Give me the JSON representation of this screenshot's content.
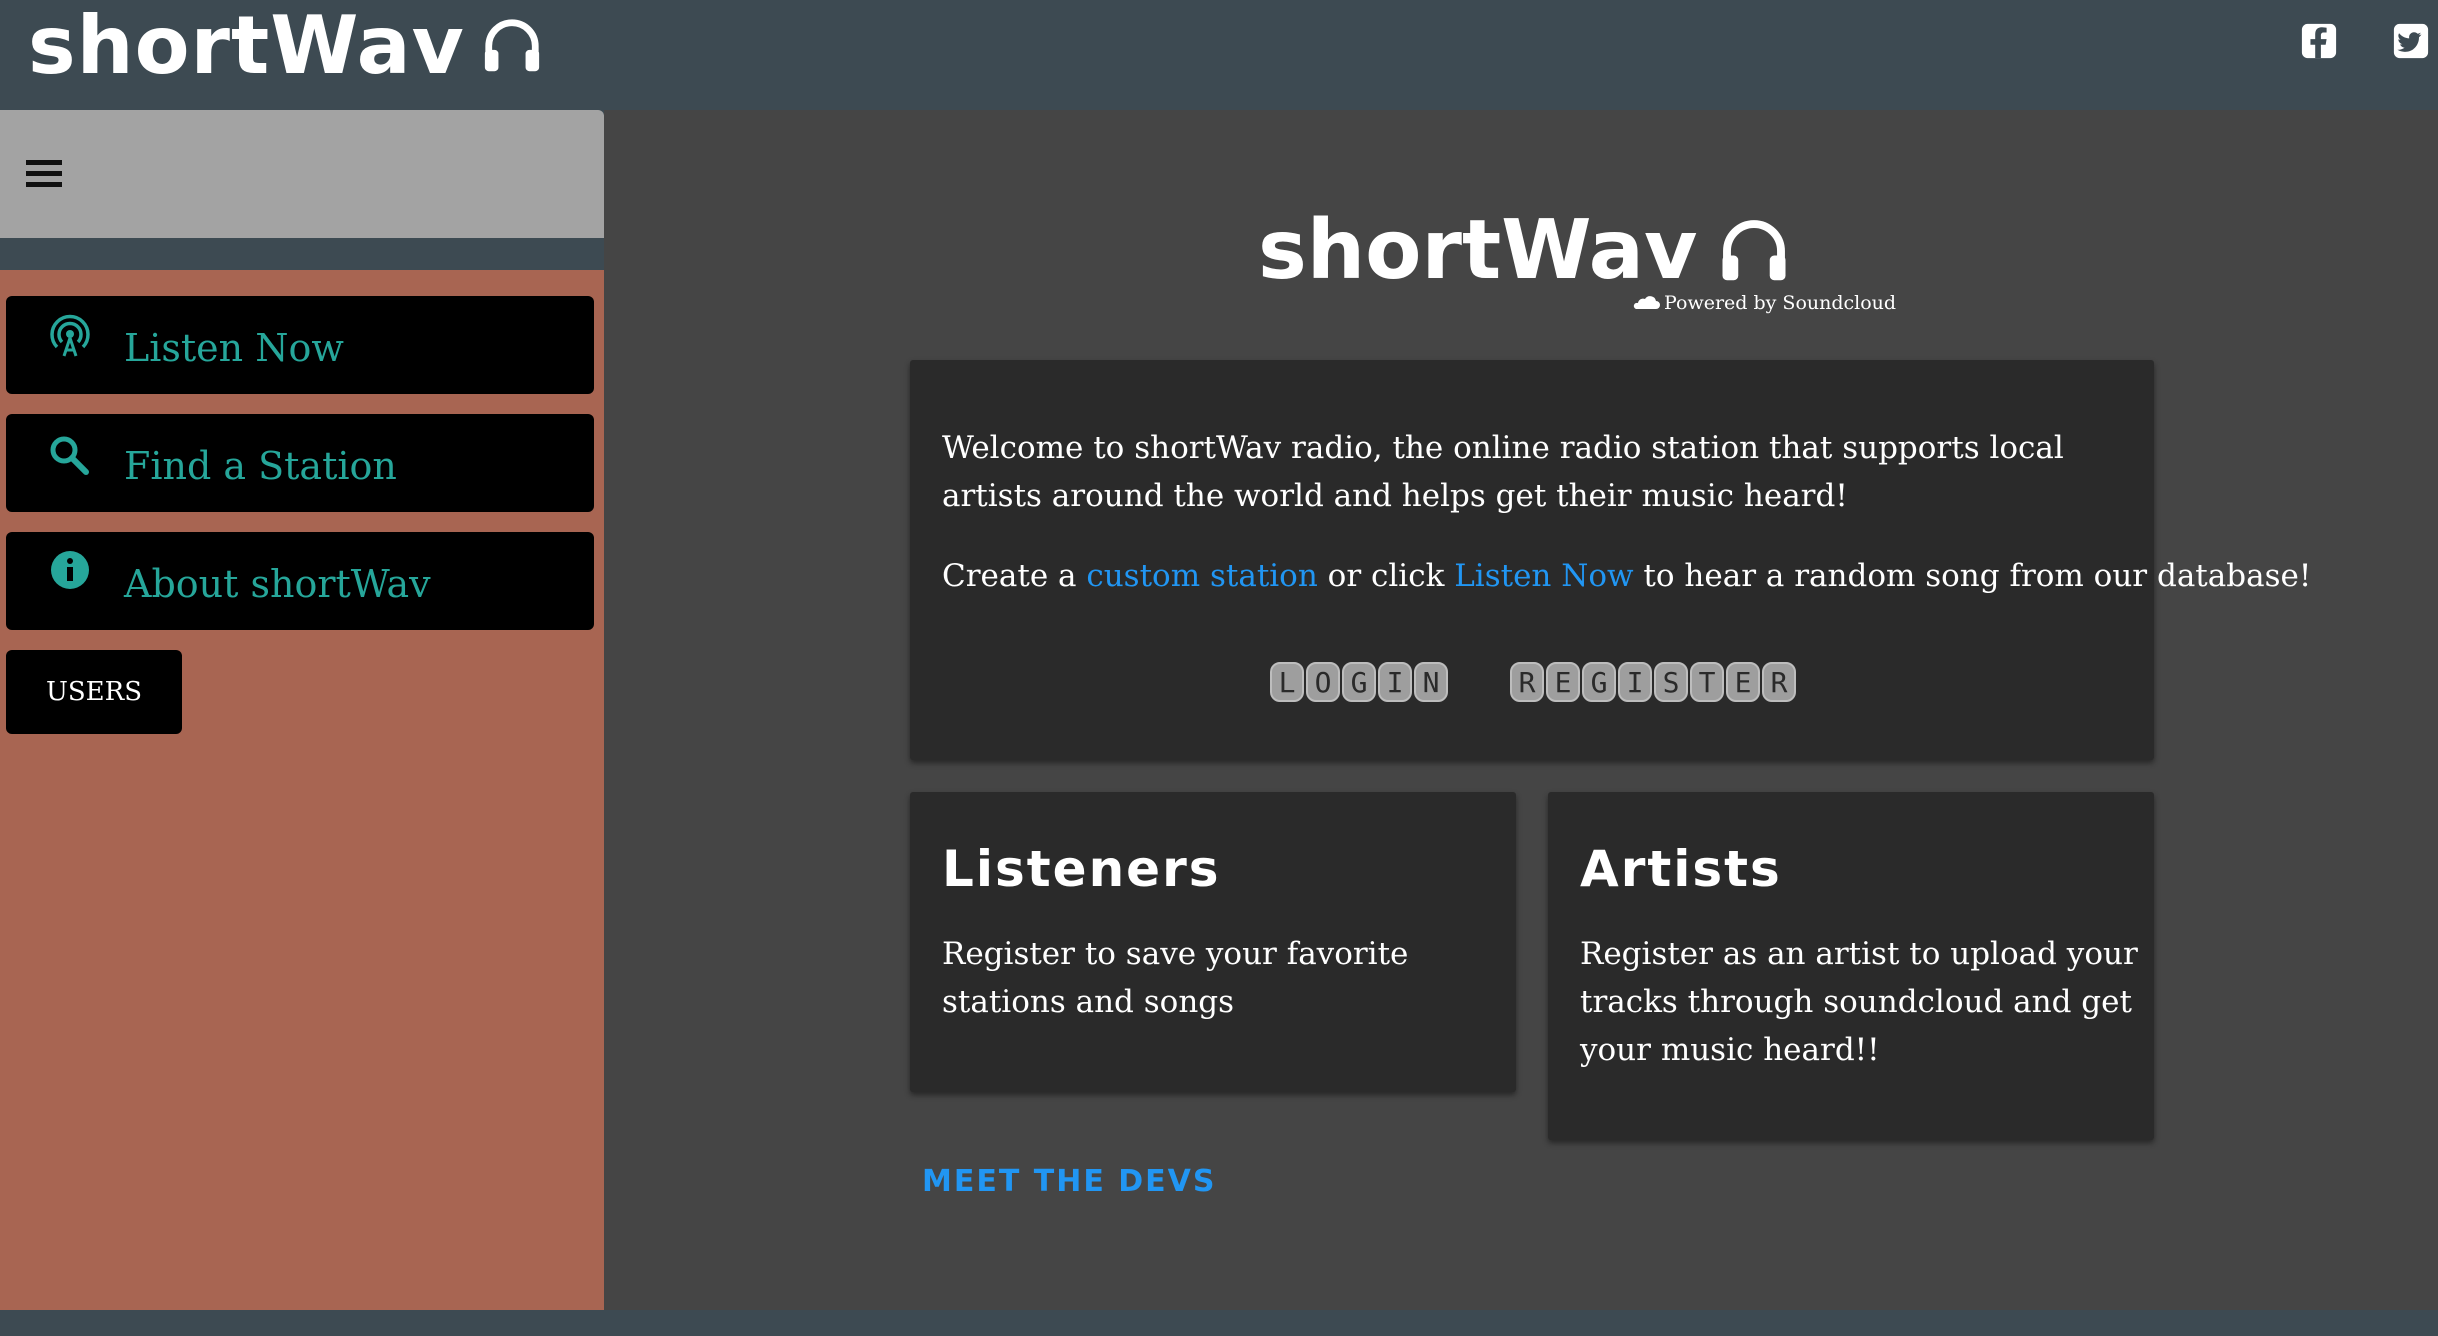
{
  "header": {
    "brand": "shortWav",
    "icons": [
      "headphones-icon",
      "facebook-icon",
      "twitter-icon"
    ]
  },
  "sidebar": {
    "menu_icon": "hamburger-menu-icon",
    "items": [
      {
        "label": "Listen Now",
        "icon": "radio-tower-icon"
      },
      {
        "label": "Find a Station",
        "icon": "search-icon"
      },
      {
        "label": "About shortWav",
        "icon": "info-icon"
      }
    ],
    "users_label": "USERS"
  },
  "main": {
    "brand": "shortWav",
    "powered_by": "Powered by Soundcloud",
    "welcome": {
      "p1": "Welcome to shortWav radio, the online radio station that supports local artists around the world and helps get their music heard!",
      "p2_before": "Create a ",
      "p2_link1": "custom station",
      "p2_middle": " or click ",
      "p2_link2": "Listen Now",
      "p2_after": " to hear a random song from our database!",
      "login_keys": [
        "L",
        "O",
        "G",
        "I",
        "N"
      ],
      "register_keys": [
        "R",
        "E",
        "G",
        "I",
        "S",
        "T",
        "E",
        "R"
      ]
    },
    "listeners": {
      "title": "Listeners",
      "text": "Register to save your favorite stations and songs"
    },
    "artists": {
      "title": "Artists",
      "text": "Register as an artist to upload your tracks through soundcloud and get your music heard!!"
    },
    "meet_devs": "MEET THE DEVS"
  },
  "colors": {
    "topbar": "#3d4a52",
    "sidebar": "#a86552",
    "sidebar_head": "#a3a3a3",
    "main": "#454545",
    "card": "#2a2a2a",
    "accent_teal": "#26a69a",
    "link_blue": "#2196f3"
  }
}
